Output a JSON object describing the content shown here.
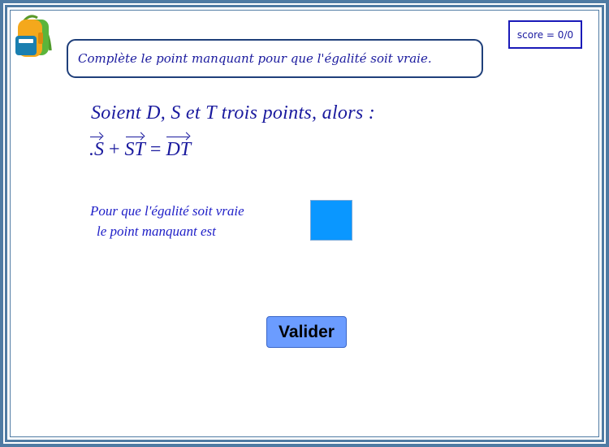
{
  "score": {
    "label": "score = 0/0"
  },
  "instruction": "Complète le point manquant pour que l'égalité soit vraie.",
  "statement": "Soient D,  S et T trois points,  alors :",
  "equation": {
    "term1": ".S",
    "plus": "+",
    "term2": "ST",
    "equals": "=",
    "term3": "DT"
  },
  "prompt": {
    "line1": "Pour que l'égalité soit vraie",
    "line2": "le point manquant est"
  },
  "answer": {
    "value": "",
    "color": "#0a97ff"
  },
  "validate_button": {
    "label": "Valider"
  },
  "icons": {
    "logo": "backpack-icon"
  },
  "colors": {
    "frame": "#4f7ba3",
    "text": "#1a1a9e",
    "button": "#6b9cff"
  }
}
